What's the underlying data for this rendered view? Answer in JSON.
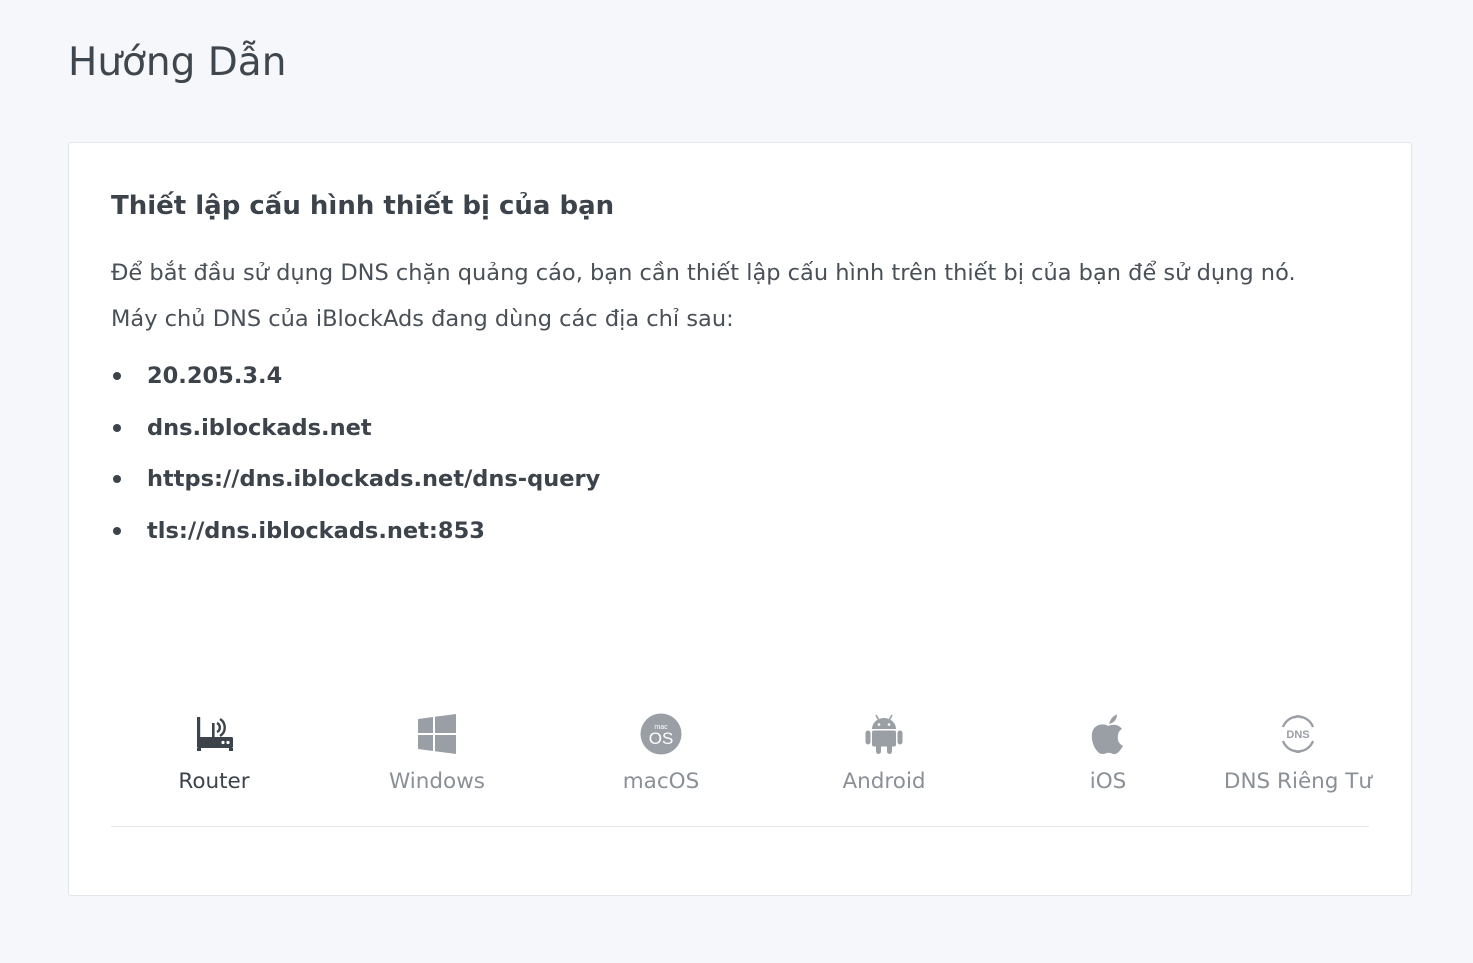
{
  "page": {
    "title": "Hướng Dẫn"
  },
  "card": {
    "title": "Thiết lập cấu hình thiết bị của bạn",
    "description_line1": "Để bắt đầu sử dụng DNS chặn quảng cáo, bạn cần thiết lập cấu hình trên thiết bị của bạn để sử dụng nó.",
    "description_line2": "Máy chủ DNS của iBlockAds đang dùng các địa chỉ sau:",
    "addresses": [
      "20.205.3.4",
      "dns.iblockads.net",
      "https://dns.iblockads.net/dns-query",
      "tls://dns.iblockads.net:853"
    ]
  },
  "tabs": [
    {
      "label": "Router",
      "icon": "router-icon",
      "active": true
    },
    {
      "label": "Windows",
      "icon": "windows-icon",
      "active": false
    },
    {
      "label": "macOS",
      "icon": "macos-icon",
      "active": false
    },
    {
      "label": "Android",
      "icon": "android-icon",
      "active": false
    },
    {
      "label": "iOS",
      "icon": "apple-icon",
      "active": false
    },
    {
      "label": "DNS Riêng Tư",
      "icon": "dns-icon",
      "active": false
    }
  ],
  "colors": {
    "background": "#f6f7fa",
    "card": "#ffffff",
    "text_dark": "#3c434b",
    "tab_inactive": "#8a9096",
    "icon_inactive": "#9a9fa5"
  }
}
